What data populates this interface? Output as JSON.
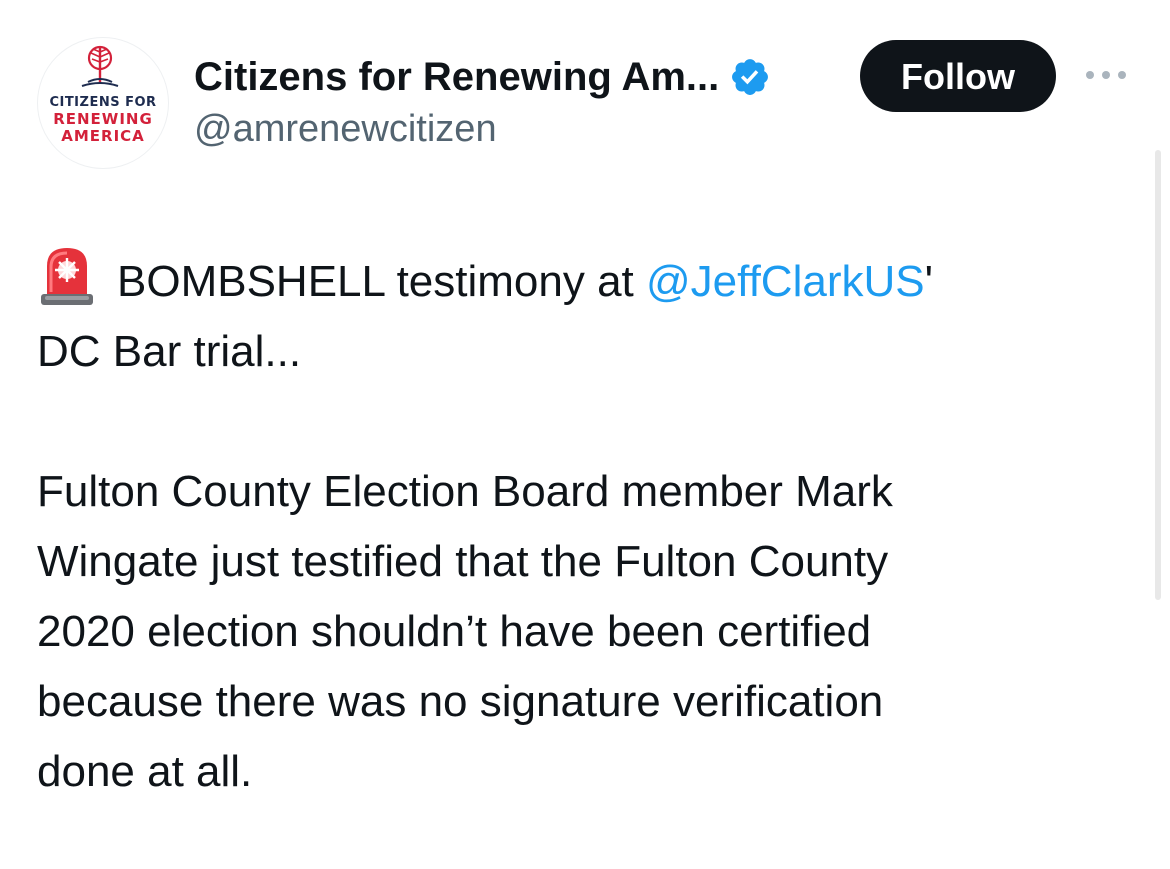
{
  "author": {
    "display_name": "Citizens for Renewing Am...",
    "handle": "@amrenewcitizen",
    "verified": true,
    "avatar_logo": {
      "line1": "CITIZENS FOR",
      "line2": "RENEWING",
      "line3": "AMERICA"
    }
  },
  "actions": {
    "follow_label": "Follow",
    "more_icon": "more-horizontal-icon"
  },
  "tweet": {
    "alert_emoji": "police-light-icon",
    "line1_text": "BOMBSHELL testimony at ",
    "mention": "@JeffClarkUS",
    "line1_suffix": "'",
    "line2": "DC Bar trial...",
    "paragraph2": [
      "Fulton County Election Board member Mark",
      "Wingate just testified that the Fulton County",
      "2020 election shouldn’t have been certified",
      "because there was no signature verification",
      "done at all."
    ]
  },
  "colors": {
    "text": "#0f1419",
    "secondary": "#536471",
    "link": "#1d9bf0",
    "verified": "#1d9bf0",
    "follow_bg": "#0f1419",
    "logo_red": "#d3213a",
    "logo_navy": "#1e2c4f"
  }
}
